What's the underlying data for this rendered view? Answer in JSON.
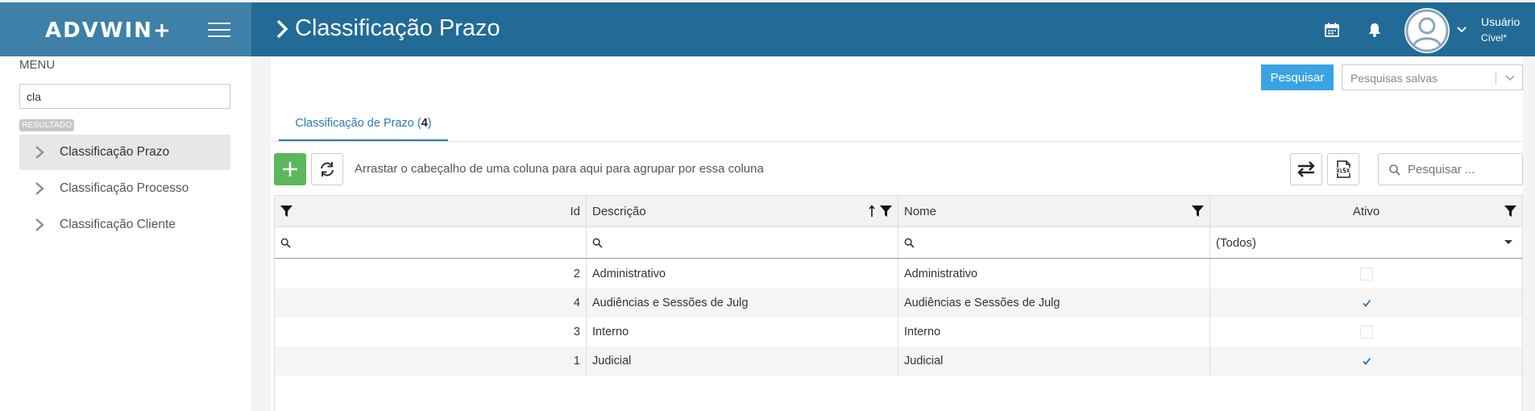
{
  "brand": {
    "logo_text": "ADVWIN+"
  },
  "header": {
    "title": "Classificação Prazo",
    "user_name": "Usuário",
    "user_sub": "Cível*"
  },
  "sidebar": {
    "menu_title": "MENU",
    "search_value": "cla",
    "result_badge": "RESULTADO",
    "items": [
      {
        "label": "Classificação Prazo",
        "active": true
      },
      {
        "label": "Classificação Processo",
        "active": false
      },
      {
        "label": "Classificação Cliente",
        "active": false
      }
    ]
  },
  "toolbar": {
    "search_button": "Pesquisar",
    "saved_searches": "Pesquisas salvas"
  },
  "tab": {
    "label": "Classificação de Prazo",
    "count": "4"
  },
  "grid_toolbar": {
    "group_hint": "Arrastar o cabeçalho de uma coluna para aqui para agrupar por essa coluna",
    "search_placeholder": "Pesquisar ..."
  },
  "table": {
    "columns": [
      "Id",
      "Descrição",
      "Nome",
      "Ativo"
    ],
    "ativo_filter": "(Todos)",
    "rows": [
      {
        "id": "2",
        "descricao": "Administrativo",
        "nome": "Administrativo",
        "ativo": false
      },
      {
        "id": "4",
        "descricao": "Audiências e Sessões de Julg",
        "nome": "Audiências e Sessões de Julg",
        "ativo": true
      },
      {
        "id": "3",
        "descricao": "Interno",
        "nome": "Interno",
        "ativo": false
      },
      {
        "id": "1",
        "descricao": "Judicial",
        "nome": "Judicial",
        "ativo": true
      }
    ]
  },
  "colors": {
    "header_bg": "#226b96",
    "brand_bg": "#3f80a8",
    "accent_blue": "#3aa3e3",
    "tab_blue": "#2a7ab5",
    "add_green": "#5cb85c"
  }
}
